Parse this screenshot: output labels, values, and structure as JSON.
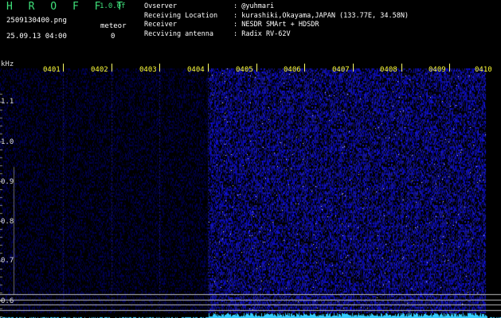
{
  "header": {
    "brand": "H R O F F T",
    "version": "1.0.0f",
    "filename": "2509130400.png",
    "meteor_label": "meteor",
    "datetime": "25.09.13 04:00",
    "meteor_count": "0",
    "info": [
      {
        "key": "Ovserver",
        "value": ": @yuhmari"
      },
      {
        "key": "Receiving Location",
        "value": ": kurashiki,Okayama,JAPAN (133.77E, 34.58N)"
      },
      {
        "key": "Receiver",
        "value": ": NESDR SMArt + HDSDR"
      },
      {
        "key": "Recviving antenna",
        "value": ": Radix RV-62V"
      }
    ]
  },
  "spectrogram": {
    "unit_label": "kHz",
    "time_marks": [
      "0401",
      "0402",
      "0403",
      "0404",
      "0405",
      "0406",
      "0407",
      "0408",
      "0409",
      "0410"
    ],
    "freq_labels": [
      "1.1",
      "1.0",
      "0.9",
      "0.8",
      "0.7",
      "0.6"
    ],
    "colors": {
      "background": "#000000",
      "signal": "#2a2aff",
      "baseline": "#33ccff",
      "brand": "#3fe07a",
      "marks": "#ffff33"
    }
  }
}
